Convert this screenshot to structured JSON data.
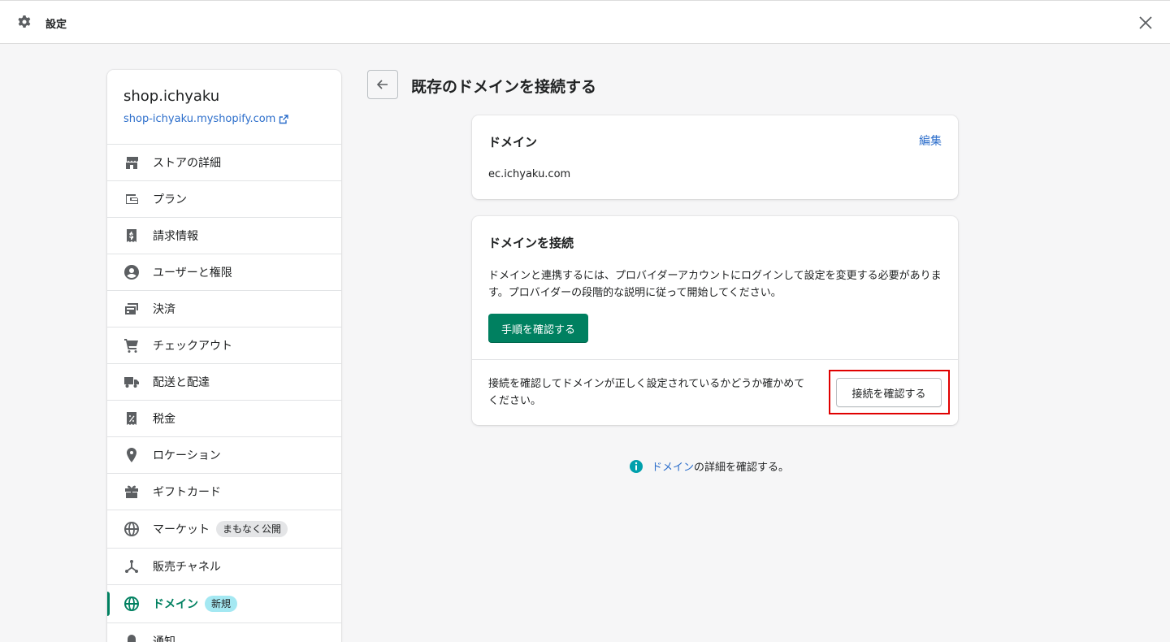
{
  "topbar": {
    "title": "設定",
    "gear_icon": "gear-icon",
    "close_icon": "close-icon"
  },
  "sidebar": {
    "store_name": "shop.ichyaku",
    "store_url": "shop-ichyaku.myshopify.com",
    "items": [
      {
        "label": "ストアの詳細",
        "icon": "store-icon"
      },
      {
        "label": "プラン",
        "icon": "wallet-icon"
      },
      {
        "label": "請求情報",
        "icon": "receipt-icon"
      },
      {
        "label": "ユーザーと権限",
        "icon": "user-icon"
      },
      {
        "label": "決済",
        "icon": "payments-icon"
      },
      {
        "label": "チェックアウト",
        "icon": "cart-icon"
      },
      {
        "label": "配送と配達",
        "icon": "truck-icon"
      },
      {
        "label": "税金",
        "icon": "tax-icon"
      },
      {
        "label": "ロケーション",
        "icon": "location-pin-icon"
      },
      {
        "label": "ギフトカード",
        "icon": "gift-icon"
      },
      {
        "label": "マーケット",
        "icon": "globe-icon",
        "badge": "まもなく公開"
      },
      {
        "label": "販売チャネル",
        "icon": "channels-icon"
      },
      {
        "label": "ドメイン",
        "icon": "domain-globe-icon",
        "badge": "新規",
        "active": true
      },
      {
        "label": "通知",
        "icon": "bell-icon"
      }
    ]
  },
  "page": {
    "title": "既存のドメインを接続する",
    "back_icon": "arrow-left-icon"
  },
  "domain_card": {
    "heading": "ドメイン",
    "edit_label": "編集",
    "domain_value": "ec.ichyaku.com"
  },
  "connect_card": {
    "heading": "ドメインを接続",
    "description": "ドメインと連携するには、プロバイダーアカウントにログインして設定を変更する必要があります。プロバイダーの段階的な説明に従って開始してください。",
    "primary_button": "手順を確認する",
    "verify_note": "接続を確認してドメインが正しく設定されているかどうか確かめてください。",
    "verify_button": "接続を確認する"
  },
  "footer": {
    "link_text": "ドメイン",
    "rest_text": "の詳細を確認する。",
    "info_icon": "info-icon"
  },
  "colors": {
    "accent": "#008060",
    "link": "#2c6ecb",
    "info": "#00a0ac",
    "highlight": "#e00000"
  }
}
